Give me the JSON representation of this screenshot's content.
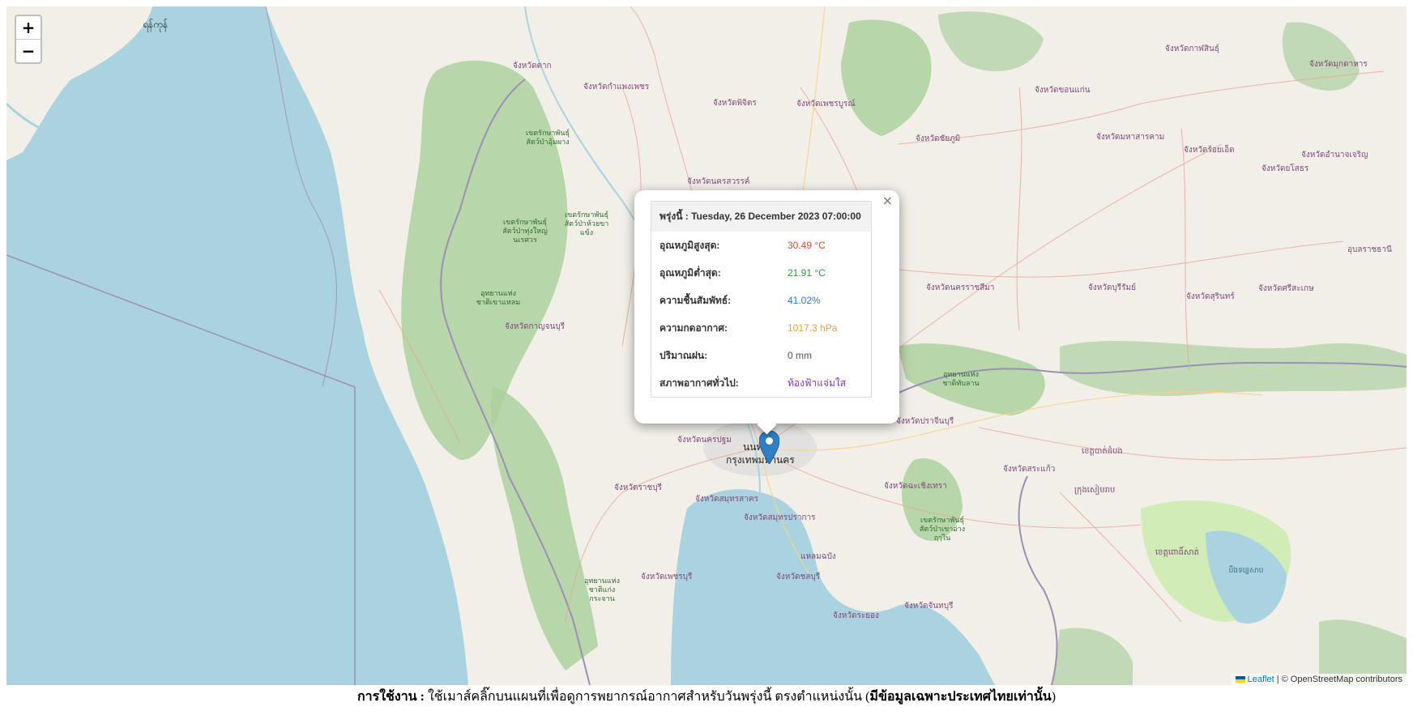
{
  "map": {
    "zoom_in": "+",
    "zoom_out": "−",
    "labels": {
      "yangon": "ရန်ကုန်",
      "bangkok_th": "กรุงเทพมหานคร",
      "bangkok_short": "นนท",
      "prov_tak": "จังหวัดตาก",
      "prov_kamphaeng": "จังหวัดกำแพงเพชร",
      "prov_phichit": "จังหวัดพิจิตร",
      "prov_phetchabun": "จังหวัดเพชรบูรณ์",
      "prov_chaiyaphum": "จังหวัดชัยภูมิ",
      "prov_khonkaen": "จังหวัดขอนแก่น",
      "prov_kalasin": "จังหวัดกาฬสินธุ์",
      "prov_mukdahan": "จังหวัดมุกดาหาร",
      "prov_mahasarakham": "จังหวัดมหาสารคาม",
      "prov_roiet": "จังหวัดร้อยเอ็ด",
      "prov_amnat": "จังหวัดอำนาจเจริญ",
      "prov_yasothon": "จังหวัดยโสธร",
      "prov_nakhonsawan": "จังหวัดนครสวรรค์",
      "prov_kanchanaburi": "จังหวัดกาญจนบุรี",
      "prov_nakhonratchasima": "จังหวัดนครราชสีมา",
      "prov_buriram": "จังหวัดบุรีรัมย์",
      "prov_surin": "จังหวัดสุรินทร์",
      "prov_sisaket": "จังหวัดศรีสะเกษ",
      "prov_ubon": "อุบลราชธานี",
      "prov_ratchaburi": "จังหวัดราชบุรี",
      "prov_samutsakhon": "จังหวัดสมุทรสาคร",
      "prov_samutprakan": "จังหวัดสมุทรปราการ",
      "prov_chachoengsao": "จังหวัดฉะเชิงเทรา",
      "prov_sakaeo": "จังหวัดสระแก้ว",
      "prov_prachinburi": "จังหวัดปราจีนบุรี",
      "prov_phetchaburi": "จังหวัดเพชรบุรี",
      "prov_chonburi": "จังหวัดชลบุรี",
      "prov_chanthaburi": "จังหวัดจันทบุรี",
      "prov_rayong": "จังหวัดระยอง",
      "prov_nakhonpathom": "จังหวัดนครปฐม",
      "laem_chabang": "แหลมฉบัง",
      "park_1": "เขตรักษาพันธุ์สัตว์ป่าอุ้มผาง",
      "park_2": "เขตรักษาพันธุ์สัตว์ป่าทุ่งใหญ่นเรศวร",
      "park_3": "เขตรักษาพันธุ์สัตว์ป่าห้วยขาแข้ง",
      "park_4": "อุทยานแห่งชาติเขาแหลม",
      "park_5": "อุทยานแห่งชาติแก่งกระจาน",
      "park_6": "เขตรักษาพันธุ์สัตว์ป่าเขาอ่างฤๅไน",
      "park_7": "อุทยานแห่งชาติทับลาน",
      "cambodia_1": "ក្រុងសៀមរាប",
      "cambodia_2": "ខេត្តបាត់ដំបង",
      "cambodia_3": "ខេត្តពោធិ៍សាត់",
      "cambodia_lake": "បឹងទន្លេសាប"
    },
    "attribution_leaflet": "Leaflet",
    "attribution_rest": "| © OpenStreetMap contributors"
  },
  "popup": {
    "close": "×",
    "header": "พรุ่งนี้ : Tuesday, 26 December 2023 07:00:00",
    "rows": [
      {
        "label": "อุณหภูมิสูงสุด:",
        "value": "30.49 °C",
        "color": "#e04b2f"
      },
      {
        "label": "อุณหภูมิต่ำสุด:",
        "value": "21.91 °C",
        "color": "#2f9a3a"
      },
      {
        "label": "ความชื้นสัมพัทธ์:",
        "value": "41.02%",
        "color": "#2f7ae0"
      },
      {
        "label": "ความกดอากาศ:",
        "value": "1017.3 hPa",
        "color": "#e8a03a"
      },
      {
        "label": "ปริมาณฝน:",
        "value": "0 mm",
        "color": "#555555"
      },
      {
        "label": "สภาพอากาศทั่วไป:",
        "value": "ท้องฟ้าแจ่มใส",
        "color": "#7a3ab8"
      }
    ]
  },
  "instructions": {
    "prefix": "การใช้งาน :",
    "text": " ใช้เมาส์คลิ๊กบนแผนที่เพื่อดูการพยากรณ์อากาศสำหรับวันพรุ่งนี้ ตรงตำแหน่งนั้น (",
    "bold": "มีข้อมูลเฉพาะประเทศไทยเท่านั้น",
    "suffix": ")"
  }
}
